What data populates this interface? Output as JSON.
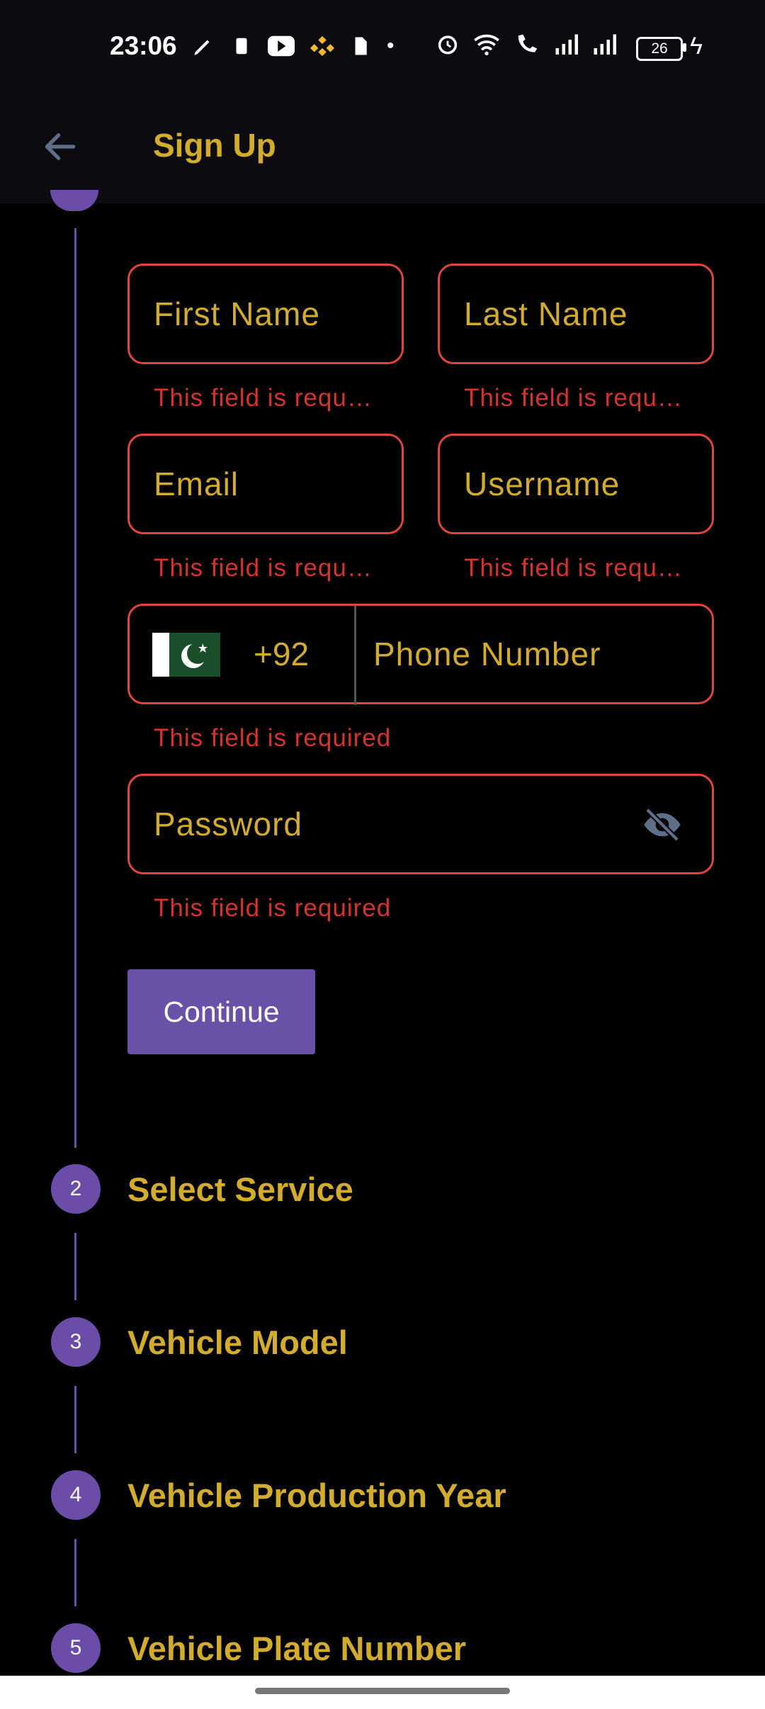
{
  "status_bar": {
    "time": "23:06",
    "battery": "26"
  },
  "app_bar": {
    "title": "Sign Up"
  },
  "form": {
    "first_name": {
      "label": "First Name",
      "error": "This field is requ…"
    },
    "last_name": {
      "label": "Last Name",
      "error": "This field is requ…"
    },
    "email": {
      "label": "Email",
      "error": "This field is requ…"
    },
    "username": {
      "label": "Username",
      "error": "This field is requ…"
    },
    "phone": {
      "country_code": "+92",
      "label": "Phone Number",
      "error": "This field is required"
    },
    "password": {
      "label": "Password",
      "error": "This field is required"
    },
    "continue_label": "Continue"
  },
  "steps": [
    {
      "number": "2",
      "label": "Select Service"
    },
    {
      "number": "3",
      "label": "Vehicle Model"
    },
    {
      "number": "4",
      "label": "Vehicle Production Year"
    },
    {
      "number": "5",
      "label": "Vehicle Plate Number"
    }
  ],
  "colors": {
    "accent": "#d4ac2b",
    "step": "#6b4ca8",
    "error": "#d7322c",
    "button": "#6a51a8"
  },
  "icons": [
    "back-arrow-icon",
    "visibility-off-icon",
    "pakistan-flag-icon"
  ]
}
